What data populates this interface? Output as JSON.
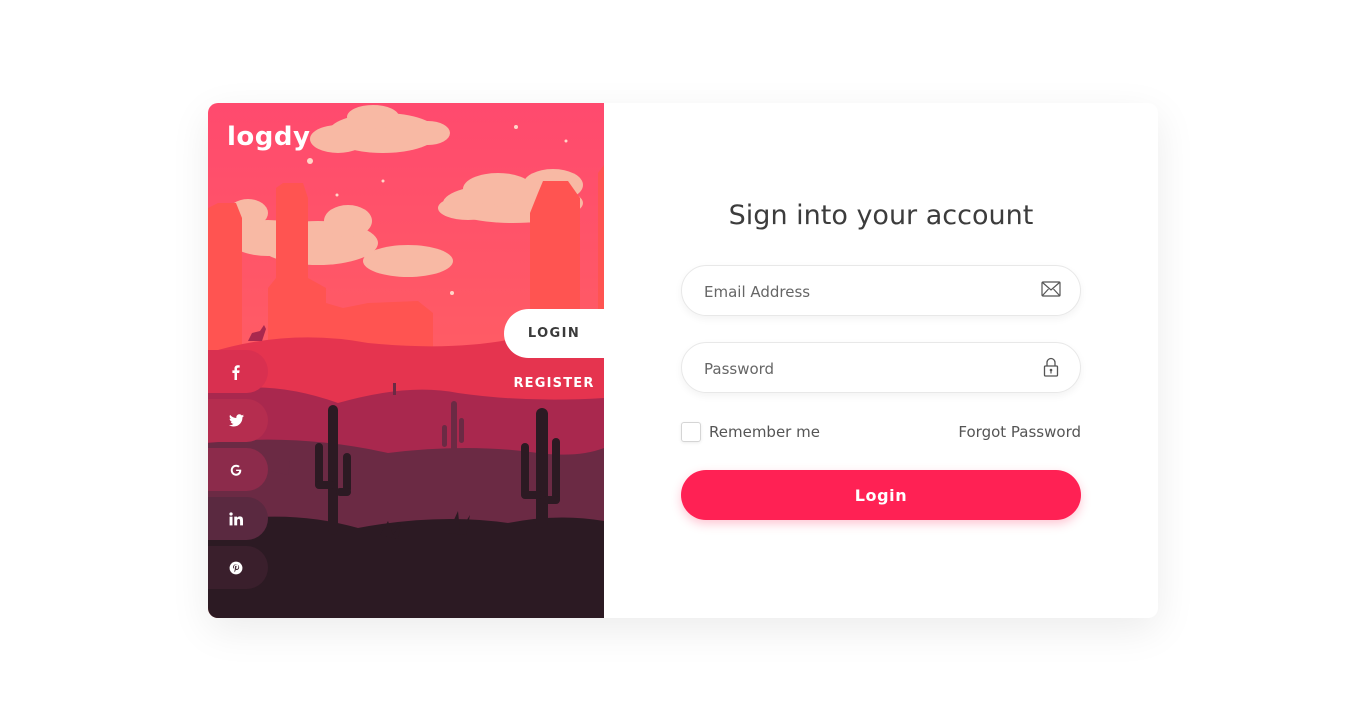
{
  "brand": {
    "logo_text": "logdy"
  },
  "side_nav": {
    "login_label": "LOGIN",
    "register_label": "REGISTER"
  },
  "social": [
    {
      "name": "facebook",
      "icon": "facebook-icon"
    },
    {
      "name": "twitter",
      "icon": "twitter-icon"
    },
    {
      "name": "google",
      "icon": "google-icon"
    },
    {
      "name": "linkedin",
      "icon": "linkedin-icon"
    },
    {
      "name": "pinterest",
      "icon": "pinterest-icon"
    }
  ],
  "form": {
    "title": "Sign into your account",
    "email_placeholder": "Email Address",
    "password_placeholder": "Password",
    "remember_label": "Remember me",
    "forgot_label": "Forgot Password",
    "submit_label": "Login"
  },
  "colors": {
    "accent": "#ff2154",
    "scene_top": "#ff4d6d",
    "scene_bottom": "#2c1a23"
  }
}
